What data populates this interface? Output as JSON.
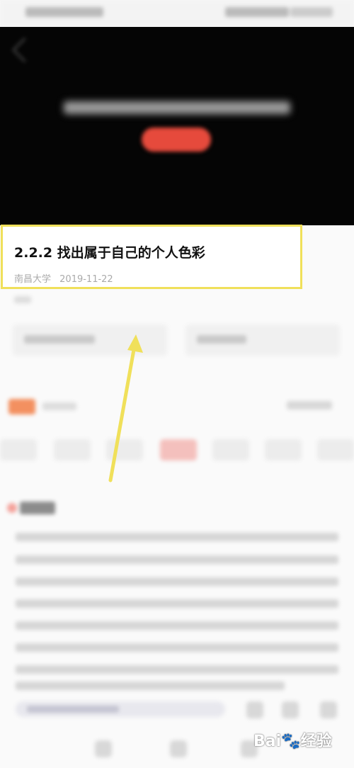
{
  "article": {
    "title": "2.2.2 找出属于自己的个人色彩",
    "source": "南昌大学",
    "date": "2019-11-22"
  },
  "colors": {
    "highlight": "#f0e05a",
    "video_button": "#e64a3c",
    "badge": "#f39060"
  },
  "icons": {
    "back": "chevron-left-icon",
    "arrow": "annotation-arrow-icon"
  },
  "watermark": {
    "brand": "Bai",
    "brand2": "经验"
  }
}
